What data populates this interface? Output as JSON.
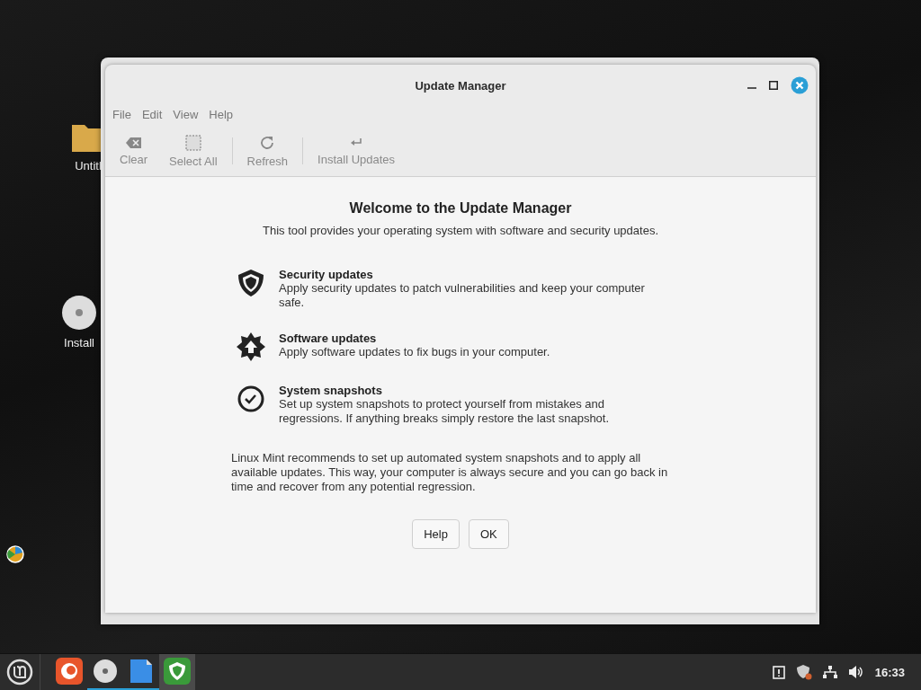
{
  "desktop": {
    "icons": [
      {
        "kind": "folder",
        "label": "Untitl"
      },
      {
        "kind": "disc",
        "label": "Install"
      }
    ]
  },
  "window": {
    "title": "Update Manager"
  },
  "menu": [
    "File",
    "Edit",
    "View",
    "Help"
  ],
  "toolbar": [
    {
      "kind": "clear",
      "label": "Clear",
      "disabled": true
    },
    {
      "kind": "select",
      "label": "Select All",
      "disabled": true
    },
    {
      "kind": "refresh",
      "label": "Refresh",
      "disabled": true
    },
    {
      "kind": "install",
      "label": "Install Updates",
      "disabled": true
    }
  ],
  "welcome": {
    "heading": "Welcome to the Update Manager",
    "intro": "This tool provides your operating system with software and security updates.",
    "features": [
      {
        "kind": "security",
        "title": "Security updates",
        "description": "Apply security updates to patch vulnerabilities and keep your computer safe."
      },
      {
        "kind": "software",
        "title": "Software updates",
        "description": "Apply software updates to fix bugs in your computer."
      },
      {
        "kind": "snapshots",
        "title": "System snapshots",
        "description": "Set up system snapshots to protect yourself from mistakes and regressions. If anything breaks simply restore the last snapshot."
      }
    ],
    "note": "Linux Mint recommends to set up automated system snapshots and to apply all available updates. This way, your computer is always secure and you can go back in time and recover from any potential regression."
  },
  "buttons": [
    "Help",
    "OK"
  ],
  "taskbar": {
    "apps": [
      {
        "kind": "firefox",
        "running": false,
        "active": false
      },
      {
        "kind": "disc",
        "running": true,
        "active": false
      },
      {
        "kind": "files",
        "running": true,
        "active": false
      },
      {
        "kind": "update",
        "running": false,
        "active": true
      }
    ],
    "clock": "16:33"
  }
}
